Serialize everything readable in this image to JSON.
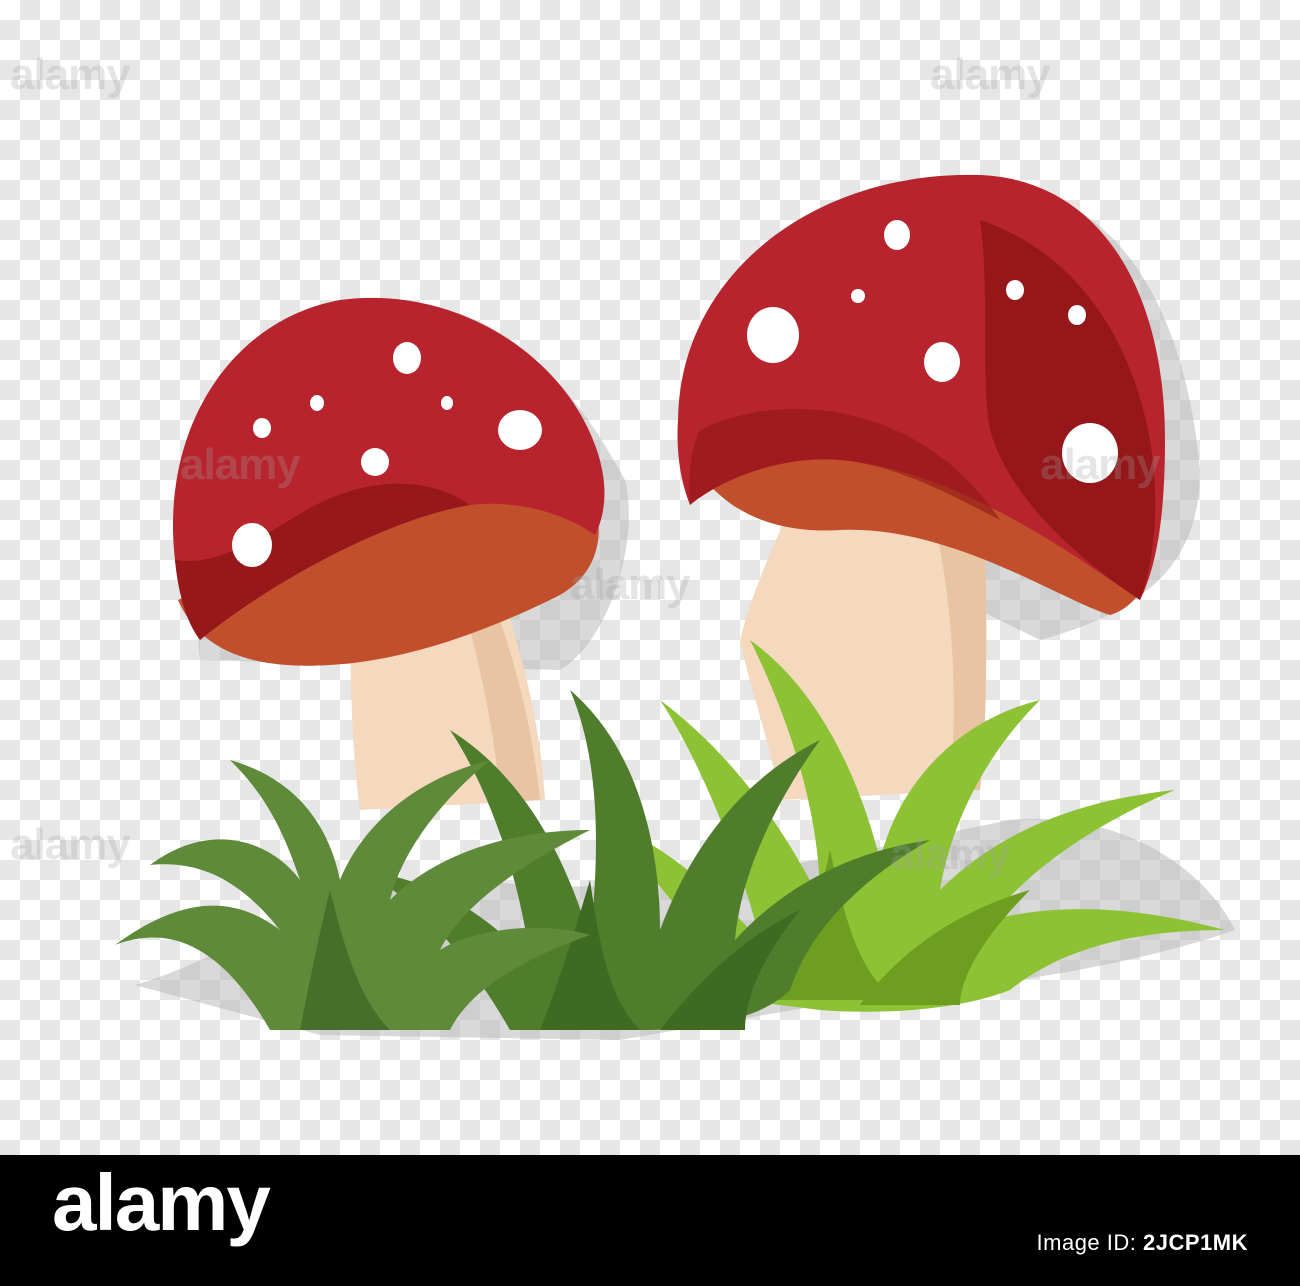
{
  "watermark": {
    "text": "alamy"
  },
  "footer": {
    "logo_text": "alamy",
    "stock_label": "Image ID:",
    "stock_id": "2JCP1MK"
  },
  "colors": {
    "cap_red": "#b8242d",
    "cap_shade": "#8c1414",
    "gill_orange": "#c14f2c",
    "stem": "#f4d9bf",
    "grass_dark": "#5f8a3a",
    "grass_mid": "#4f7d2c",
    "grass_light": "#8cc234",
    "footer_bg": "#000000"
  },
  "icons": [
    "mushroom-illustration",
    "grass-illustration",
    "checkerboard-background"
  ]
}
